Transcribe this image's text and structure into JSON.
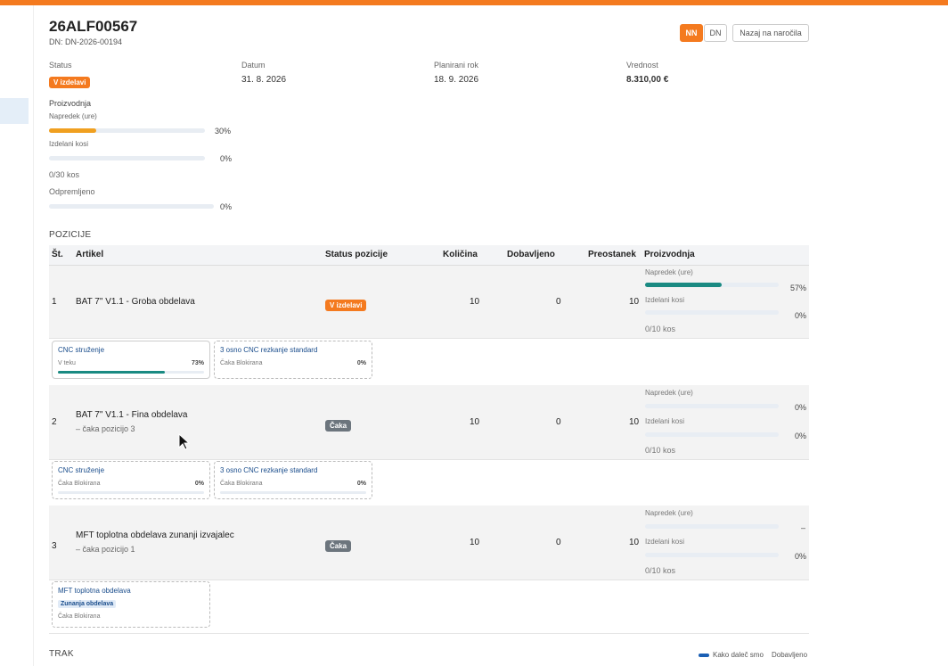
{
  "header": {
    "order_no": "26ALF00567",
    "dn": "DN: DN-2026-00194",
    "toggle_nn": "NN",
    "toggle_dn": "DN",
    "back_label": "Nazaj na naročila"
  },
  "summary": {
    "status_label": "Status",
    "status_value": "V izdelavi",
    "date_label": "Datum",
    "date_value": "31. 8. 2026",
    "deadline_label": "Planirani rok",
    "deadline_value": "18. 9. 2026",
    "value_label": "Vrednost",
    "value_value": "8.310,00 €"
  },
  "production": {
    "title": "Proizvodnja",
    "progress_label": "Napredek (ure)",
    "progress_pct": 30,
    "progress_text": "30%",
    "pieces_label": "Izdelani kosi",
    "pieces_pct": 0,
    "pieces_text": "0%",
    "pieces_count": "0/30 kos",
    "shipped_label": "Odpremljeno",
    "shipped_pct": 0,
    "shipped_text": "0%"
  },
  "positions": {
    "title": "POZICIJE",
    "columns": {
      "no": "Št.",
      "article": "Artikel",
      "status": "Status pozicije",
      "qty": "Količina",
      "delivered": "Dobavljeno",
      "remaining": "Preostanek",
      "production": "Proizvodnja"
    },
    "rows": [
      {
        "no": "1",
        "article": "BAT 7\" V1.1 - Groba obdelava",
        "note": "",
        "status": "V izdelavi",
        "qty": "10",
        "delivered": "0",
        "remaining": "10",
        "prog_label": "Napredek (ure)",
        "prog_pct": 57,
        "prog_text": "57%",
        "pcs_label": "Izdelani kosi",
        "pcs_text": "0%",
        "pcs_count": "0/10 kos",
        "ops": [
          {
            "name": "CNC struženje",
            "status": "V teku",
            "pct": 73,
            "pct_text": "73%"
          },
          {
            "name": "3 osno CNC rezkanje standard",
            "status": "Čaka  Blokirana",
            "pct": 0,
            "pct_text": "0%"
          }
        ]
      },
      {
        "no": "2",
        "article": "BAT 7\" V1.1 - Fina obdelava",
        "note": "– čaka pozicijo 3",
        "status": "Čaka",
        "qty": "10",
        "delivered": "0",
        "remaining": "10",
        "prog_label": "Napredek (ure)",
        "prog_pct": 0,
        "prog_text": "0%",
        "pcs_label": "Izdelani kosi",
        "pcs_text": "0%",
        "pcs_count": "0/10 kos",
        "ops": [
          {
            "name": "CNC struženje",
            "status": "Čaka  Blokirana",
            "pct": 0,
            "pct_text": "0%"
          },
          {
            "name": "3 osno CNC rezkanje standard",
            "status": "Čaka  Blokirana",
            "pct": 0,
            "pct_text": "0%"
          }
        ]
      },
      {
        "no": "3",
        "article": "MFT toplotna obdelava zunanji izvajalec",
        "note": "– čaka pozicijo 1",
        "status": "Čaka",
        "qty": "10",
        "delivered": "0",
        "remaining": "10",
        "prog_label": "Napredek (ure)",
        "prog_pct": 0,
        "prog_text": "–",
        "pcs_label": "Izdelani kosi",
        "pcs_text": "0%",
        "pcs_count": "0/10 kos",
        "ops": [
          {
            "name": "MFT toplotna obdelava",
            "tag": "Zunanja obdelava",
            "status": "Čaka  Blokirana"
          }
        ]
      }
    ]
  },
  "track": {
    "title": "TRAK",
    "legend_progress": "Kako daleč smo",
    "legend_delivered": "Dobavljeno"
  },
  "colors": {
    "accent": "#f47a1f",
    "progress_orange": "#f0a020",
    "progress_teal": "#1a8a82",
    "status_gray": "#6c757d"
  }
}
